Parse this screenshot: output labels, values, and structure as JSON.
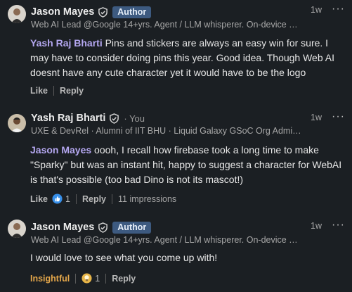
{
  "comments": [
    {
      "name": "Jason Mayes",
      "badge": "Author",
      "time": "1w",
      "subtitle": "Web AI Lead @Google 14+yrs. Agent / LLM whisperer. On-device …",
      "mention": "Yash Raj Bharti",
      "text": " Pins and stickers are always an easy win for sure. I may have to consider doing pins this year. Good idea. Though Web AI doesnt have any cute character yet it would have to be the logo",
      "like_label": "Like",
      "reply_label": "Reply"
    },
    {
      "name": "Yash Raj Bharti",
      "you_label": "· You",
      "time": "1w",
      "subtitle": "UXE & DevRel · Alumni of IIT BHU · Liquid Galaxy GSoC Org Admi…",
      "mention": "Jason Mayes",
      "text": " oooh, I recall how firebase took a long time to make \"Sparky\" but was an instant hit, happy to suggest a character for WebAI is that's possible (too bad Dino is not its mascot!)",
      "like_label": "Like",
      "reaction_count": "1",
      "reply_label": "Reply",
      "impressions": "11 impressions"
    },
    {
      "name": "Jason Mayes",
      "badge": "Author",
      "time": "1w",
      "subtitle": "Web AI Lead @Google 14+yrs. Agent / LLM whisperer. On-device …",
      "text": "I would love to see what you come up with!",
      "reaction_label": "Insightful",
      "reaction_count": "1",
      "reply_label": "Reply"
    }
  ],
  "icons": {
    "verified": "verified-shield-icon",
    "like_reaction": "thumbs-up-icon",
    "insightful_reaction": "lightbulb-icon",
    "more": "more-options-icon"
  },
  "colors": {
    "background": "#1b1f23",
    "mention": "#b4a7f0",
    "author_badge": "#3d5a80",
    "insightful": "#e3a64a",
    "like_blue": "#378fe9"
  }
}
